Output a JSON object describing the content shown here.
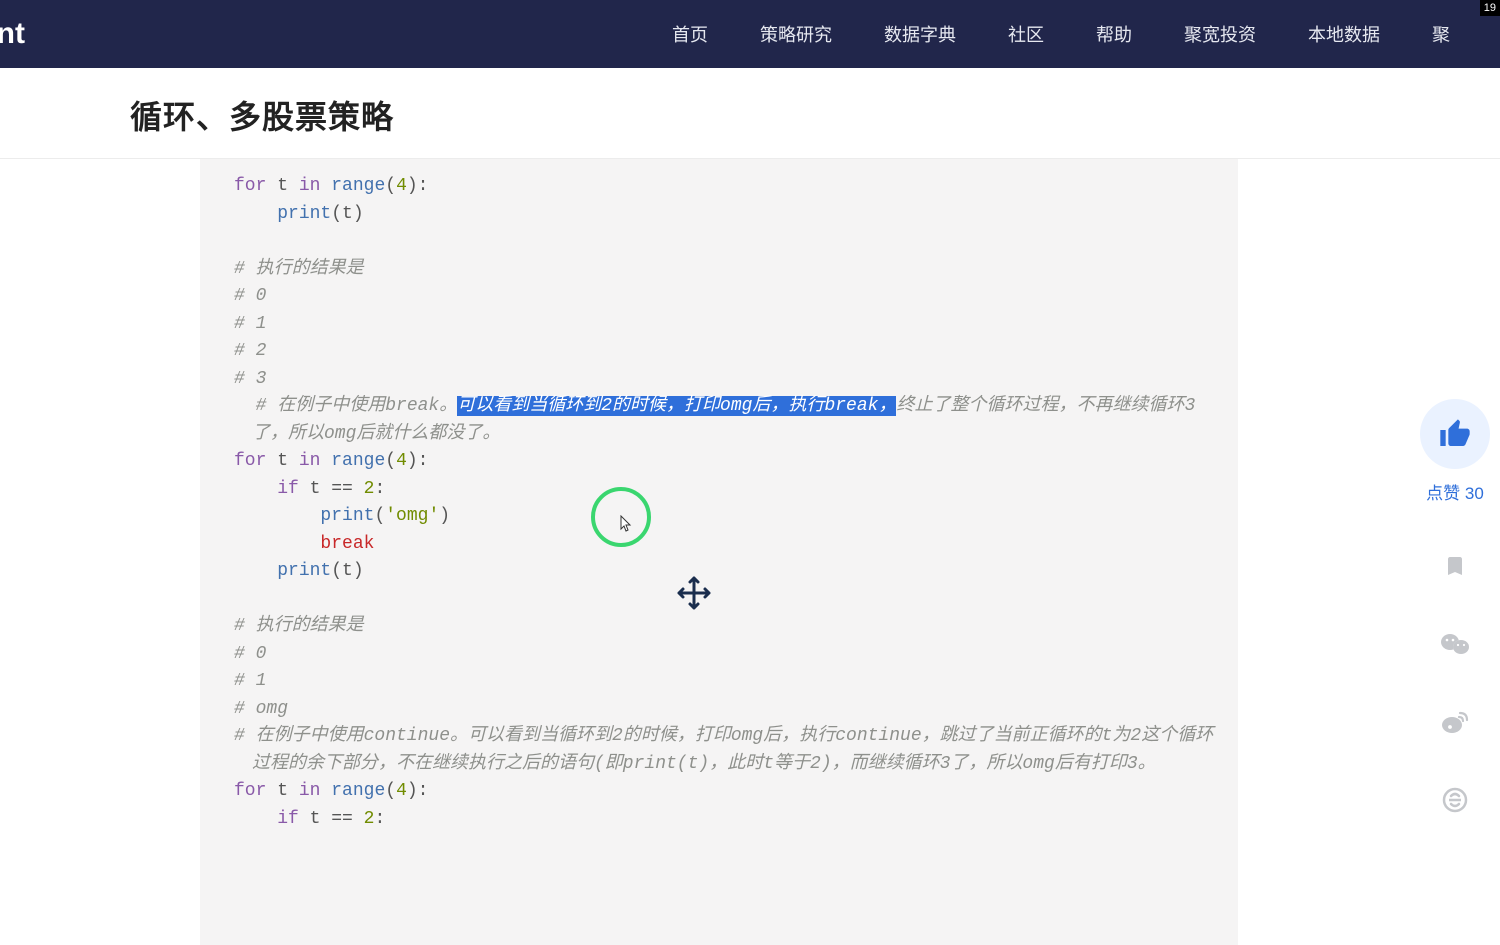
{
  "header": {
    "logo": "ant",
    "nav": [
      "首页",
      "策略研究",
      "数据字典",
      "社区",
      "帮助",
      "聚宽投资",
      "本地数据",
      "聚"
    ],
    "badge": "19"
  },
  "title": "循环、多股票策略",
  "code": {
    "l1_for": "for",
    "l1_t": " t ",
    "l1_in": "in",
    "l1_sp": " ",
    "l1_range": "range",
    "l1_paren_o": "(",
    "l1_4": "4",
    "l1_paren_c": "):",
    "l2_print": "print",
    "l2_po": "(",
    "l2_t": "t",
    "l2_pc": ")",
    "c_result": "# 执行的结果是",
    "c_0": "# 0",
    "c_1": "# 1",
    "c_2": "# 2",
    "c_3": "# 3",
    "break_pre": "# 在例子中使用break。",
    "break_hl": "可以看到当循环到2的时候，打印omg后，执行break，",
    "break_post": "终止了整个循环过程，不再继续循环3了，所以omg后就什么都没了。",
    "l3_for": "for",
    "l3_mid": " t ",
    "l3_in": "in",
    "l3_sp": " ",
    "l3_range": "range",
    "l3_po": "(",
    "l3_4": "4",
    "l3_pc": "):",
    "l4_if": "if",
    "l4_cond": " t == ",
    "l4_2": "2",
    "l4_colon": ":",
    "l5_print": "print",
    "l5_po": "(",
    "l5_omg": "'omg'",
    "l5_pc": ")",
    "l6_break": "break",
    "l7_print": "print",
    "l7_po": "(",
    "l7_t": "t",
    "l7_pc": ")",
    "c_result2": "# 执行的结果是",
    "c2_0": "# 0",
    "c2_1": "# 1",
    "c2_omg": "# omg",
    "continue_comment": "# 在例子中使用continue。可以看到当循环到2的时候，打印omg后，执行continue，跳过了当前正循环的t为2这个循环过程的余下部分，不在继续执行之后的语句(即print(t)，此时t等于2)，而继续循环3了，所以omg后有打印3。",
    "l8_for": "for",
    "l8_mid": " t ",
    "l8_in": "in",
    "l8_sp": " ",
    "l8_range": "range",
    "l8_po": "(",
    "l8_4": "4",
    "l8_pc": "):",
    "l9_if": "if",
    "l9_cond": " t == ",
    "l9_2": "2",
    "l9_colon": ":"
  },
  "sidebar": {
    "like_glyph": "👍",
    "like_label": "点赞 30"
  }
}
